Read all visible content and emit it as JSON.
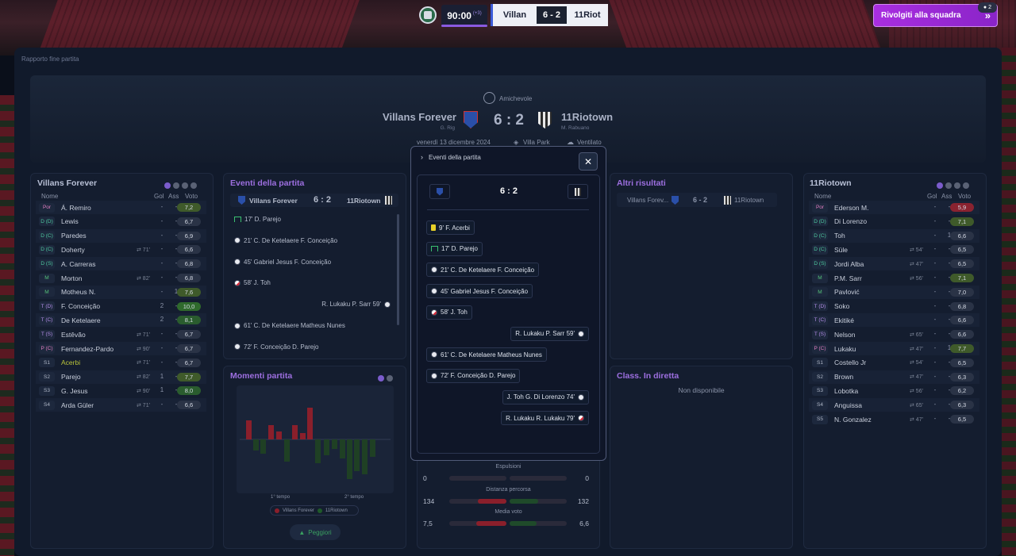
{
  "topbar": {
    "clock": "90:00",
    "added": "(+3)",
    "home_short": "Villan",
    "score": "6 - 2",
    "away_short": "11Riot",
    "cta": "Rivolgiti alla squadra",
    "cta_badge": "2"
  },
  "page": {
    "label": "Rapporto fine partita"
  },
  "banner": {
    "competition": "Amichevole",
    "home": "Villans Forever",
    "home_manager": "G. Rig",
    "away": "11Riotown",
    "away_manager": "M. Rabuano",
    "score": "6 : 2",
    "date": "venerdì 13 dicembre 2024",
    "stadium": "Villa Park",
    "weather": "Ventilato"
  },
  "home_panel": {
    "title": "Villans Forever",
    "headers": {
      "name": "Nome",
      "gol": "Gol",
      "ass": "Ass",
      "voto": "Voto"
    },
    "rows": [
      {
        "pos": "Por",
        "name": "Á. Remiro",
        "sub": "",
        "gol": "-",
        "ass": "-",
        "voto": "7,2",
        "vc": "#3f5a2a"
      },
      {
        "pos": "D (D)",
        "name": "Lewis",
        "sub": "",
        "gol": "-",
        "ass": "-",
        "voto": "6,7",
        "vc": "#2a3346"
      },
      {
        "pos": "D (C)",
        "name": "Paredes",
        "sub": "",
        "gol": "-",
        "ass": "-",
        "voto": "6,9",
        "vc": "#2a3346"
      },
      {
        "pos": "D (C)",
        "name": "Doherty",
        "sub": "71'",
        "gol": "-",
        "ass": "-",
        "voto": "6,6",
        "vc": "#2a3346"
      },
      {
        "pos": "D (S)",
        "name": "A. Carreras",
        "sub": "",
        "gol": "-",
        "ass": "-",
        "voto": "6,8",
        "vc": "#2a3346"
      },
      {
        "pos": "M",
        "name": "Morton",
        "sub": "82'",
        "gol": "-",
        "ass": "-",
        "voto": "6,8",
        "vc": "#2a3346"
      },
      {
        "pos": "M",
        "name": "Motheus N.",
        "sub": "",
        "gol": "-",
        "ass": "1",
        "voto": "7,6",
        "vc": "#3f5a2a"
      },
      {
        "pos": "T (D)",
        "name": "F. Conceição",
        "sub": "",
        "gol": "2",
        "ass": "-",
        "voto": "10,0",
        "vc": "#2f6a2c"
      },
      {
        "pos": "T (C)",
        "name": "De Ketelaere",
        "sub": "",
        "gol": "2",
        "ass": "-",
        "voto": "8,1",
        "vc": "#2a5c2e"
      },
      {
        "pos": "T (S)",
        "name": "Estêvão",
        "sub": "71'",
        "gol": "-",
        "ass": "-",
        "voto": "6,7",
        "vc": "#2a3346"
      },
      {
        "pos": "P (C)",
        "name": "Fernandez-Pardo",
        "sub": "90'",
        "gol": "-",
        "ass": "-",
        "voto": "6,7",
        "vc": "#2a3346"
      },
      {
        "pos": "S1",
        "name": "Acerbi",
        "sub": "71'",
        "gol": "-",
        "ass": "-",
        "voto": "6,7",
        "vc": "#2a3346"
      },
      {
        "pos": "S2",
        "name": "Parejo",
        "sub": "82'",
        "gol": "1",
        "ass": "-",
        "voto": "7,7",
        "vc": "#3f5a2a"
      },
      {
        "pos": "S3",
        "name": "G. Jesus",
        "sub": "90'",
        "gol": "1",
        "ass": "-",
        "voto": "8,0",
        "vc": "#2a5c2e"
      },
      {
        "pos": "S4",
        "name": "Arda Güler",
        "sub": "71'",
        "gol": "-",
        "ass": "-",
        "voto": "6,6",
        "vc": "#2a3346"
      }
    ]
  },
  "events_panel": {
    "title": "Eventi della partita",
    "home": "Villans Forever",
    "away": "11Riotown",
    "score": "6 : 2",
    "items": [
      {
        "side": "home",
        "text": "17'  D. Parejo",
        "icon": "penalty"
      },
      {
        "side": "home",
        "text": "21'  C. De Ketelaere  F. Conceição",
        "icon": "ball"
      },
      {
        "side": "home",
        "text": "45'  Gabriel Jesus  F. Conceição",
        "icon": "ball"
      },
      {
        "side": "home",
        "text": "58'  J. Toh",
        "icon": "owngoal"
      },
      {
        "side": "away",
        "text": "R. Lukaku  P. Sarr  59'",
        "icon": "ball"
      },
      {
        "side": "home",
        "text": "61'  C. De Ketelaere  Matheus Nunes",
        "icon": "ball"
      },
      {
        "side": "home",
        "text": "72'  F. Conceição  D. Parejo",
        "icon": "ball"
      }
    ]
  },
  "moments_panel": {
    "title": "Momenti partita",
    "first": "1° tempo",
    "second": "2° tempo",
    "legend_home": "Villans Forever",
    "legend_away": "11Riotown",
    "button": "Peggiori"
  },
  "stats": {
    "rows": [
      {
        "label": "Espulsioni",
        "home": "0",
        "away": "0",
        "hf": 0,
        "af": 0
      },
      {
        "label": "Distanza percorsa",
        "home": "134",
        "away": "132",
        "hf": 0.5,
        "af": 0.5
      },
      {
        "label": "Media voto",
        "home": "7,5",
        "away": "6,6",
        "hf": 0.53,
        "af": 0.47
      }
    ]
  },
  "other_panel": {
    "title": "Altri risultati",
    "home": "Villans Forev...",
    "score": "6 - 2",
    "away": "11Riotown"
  },
  "live_panel": {
    "title": "Class. In diretta",
    "empty": "Non disponibile"
  },
  "away_panel": {
    "title": "11Riotown",
    "headers": {
      "name": "Nome",
      "gol": "Gol",
      "ass": "Ass",
      "voto": "Voto"
    },
    "rows": [
      {
        "pos": "Por",
        "name": "Ederson M.",
        "sub": "",
        "gol": "-",
        "ass": "-",
        "voto": "5,9",
        "vc": "#8a2330"
      },
      {
        "pos": "D (D)",
        "name": "Di Lorenzo",
        "sub": "",
        "gol": "-",
        "ass": "-",
        "voto": "7,1",
        "vc": "#3f5a2a"
      },
      {
        "pos": "D (C)",
        "name": "Toh",
        "sub": "",
        "gol": "-",
        "ass": "1",
        "voto": "6,6",
        "vc": "#2a3346"
      },
      {
        "pos": "D (C)",
        "name": "Süle",
        "sub": "54'",
        "gol": "-",
        "ass": "-",
        "voto": "6,5",
        "vc": "#2a3346"
      },
      {
        "pos": "D (S)",
        "name": "Jordi Alba",
        "sub": "47'",
        "gol": "-",
        "ass": "-",
        "voto": "6,5",
        "vc": "#2a3346"
      },
      {
        "pos": "M",
        "name": "P.M. Sarr",
        "sub": "56'",
        "gol": "-",
        "ass": "-",
        "voto": "7,1",
        "vc": "#3f5a2a"
      },
      {
        "pos": "M",
        "name": "Pavlović",
        "sub": "",
        "gol": "-",
        "ass": "-",
        "voto": "7,0",
        "vc": "#2a3346"
      },
      {
        "pos": "T (D)",
        "name": "Soko",
        "sub": "",
        "gol": "-",
        "ass": "-",
        "voto": "6,8",
        "vc": "#2a3346"
      },
      {
        "pos": "T (C)",
        "name": "Ekitiké",
        "sub": "",
        "gol": "-",
        "ass": "-",
        "voto": "6,6",
        "vc": "#2a3346"
      },
      {
        "pos": "T (S)",
        "name": "Nelson",
        "sub": "65'",
        "gol": "-",
        "ass": "-",
        "voto": "6,6",
        "vc": "#2a3346"
      },
      {
        "pos": "P (C)",
        "name": "Lukaku",
        "sub": "47'",
        "gol": "-",
        "ass": "1",
        "voto": "7,7",
        "vc": "#3f5a2a"
      },
      {
        "pos": "S1",
        "name": "Costello Jr",
        "sub": "54'",
        "gol": "-",
        "ass": "-",
        "voto": "6,5",
        "vc": "#2a3346"
      },
      {
        "pos": "S2",
        "name": "Brown",
        "sub": "47'",
        "gol": "-",
        "ass": "-",
        "voto": "6,3",
        "vc": "#2a3346"
      },
      {
        "pos": "S3",
        "name": "Lobotka",
        "sub": "56'",
        "gol": "-",
        "ass": "-",
        "voto": "6,2",
        "vc": "#2a3346"
      },
      {
        "pos": "S4",
        "name": "Anguissa",
        "sub": "65'",
        "gol": "-",
        "ass": "-",
        "voto": "6,3",
        "vc": "#2a3346"
      },
      {
        "pos": "S5",
        "name": "N. Gonzalez",
        "sub": "47'",
        "gol": "-",
        "ass": "-",
        "voto": "6,5",
        "vc": "#2a3346"
      }
    ]
  },
  "modal": {
    "title": "Eventi della partita",
    "score": "6 : 2",
    "events": [
      {
        "side": "home",
        "text": "9'  F. Acerbi",
        "icon": "yellow"
      },
      {
        "side": "home",
        "text": "17'  D. Parejo",
        "icon": "penalty"
      },
      {
        "side": "home",
        "text": "21'  C. De Ketelaere  F. Conceição",
        "icon": "ball"
      },
      {
        "side": "home",
        "text": "45'  Gabriel Jesus  F. Conceição",
        "icon": "ball"
      },
      {
        "side": "home",
        "text": "58'  J. Toh",
        "icon": "owngoal"
      },
      {
        "side": "away",
        "text": "R. Lukaku  P. Sarr  59'",
        "icon": "ball"
      },
      {
        "side": "home",
        "text": "61'  C. De Ketelaere  Matheus Nunes",
        "icon": "ball"
      },
      {
        "side": "home",
        "text": "72'  F. Conceição  D. Parejo",
        "icon": "ball"
      },
      {
        "side": "away",
        "text": "J. Toh  G. Di Lorenzo  74'",
        "icon": "ball"
      },
      {
        "side": "away",
        "text": "R. Lukaku  R. Lukaku  79'",
        "icon": "owngoal"
      }
    ]
  }
}
